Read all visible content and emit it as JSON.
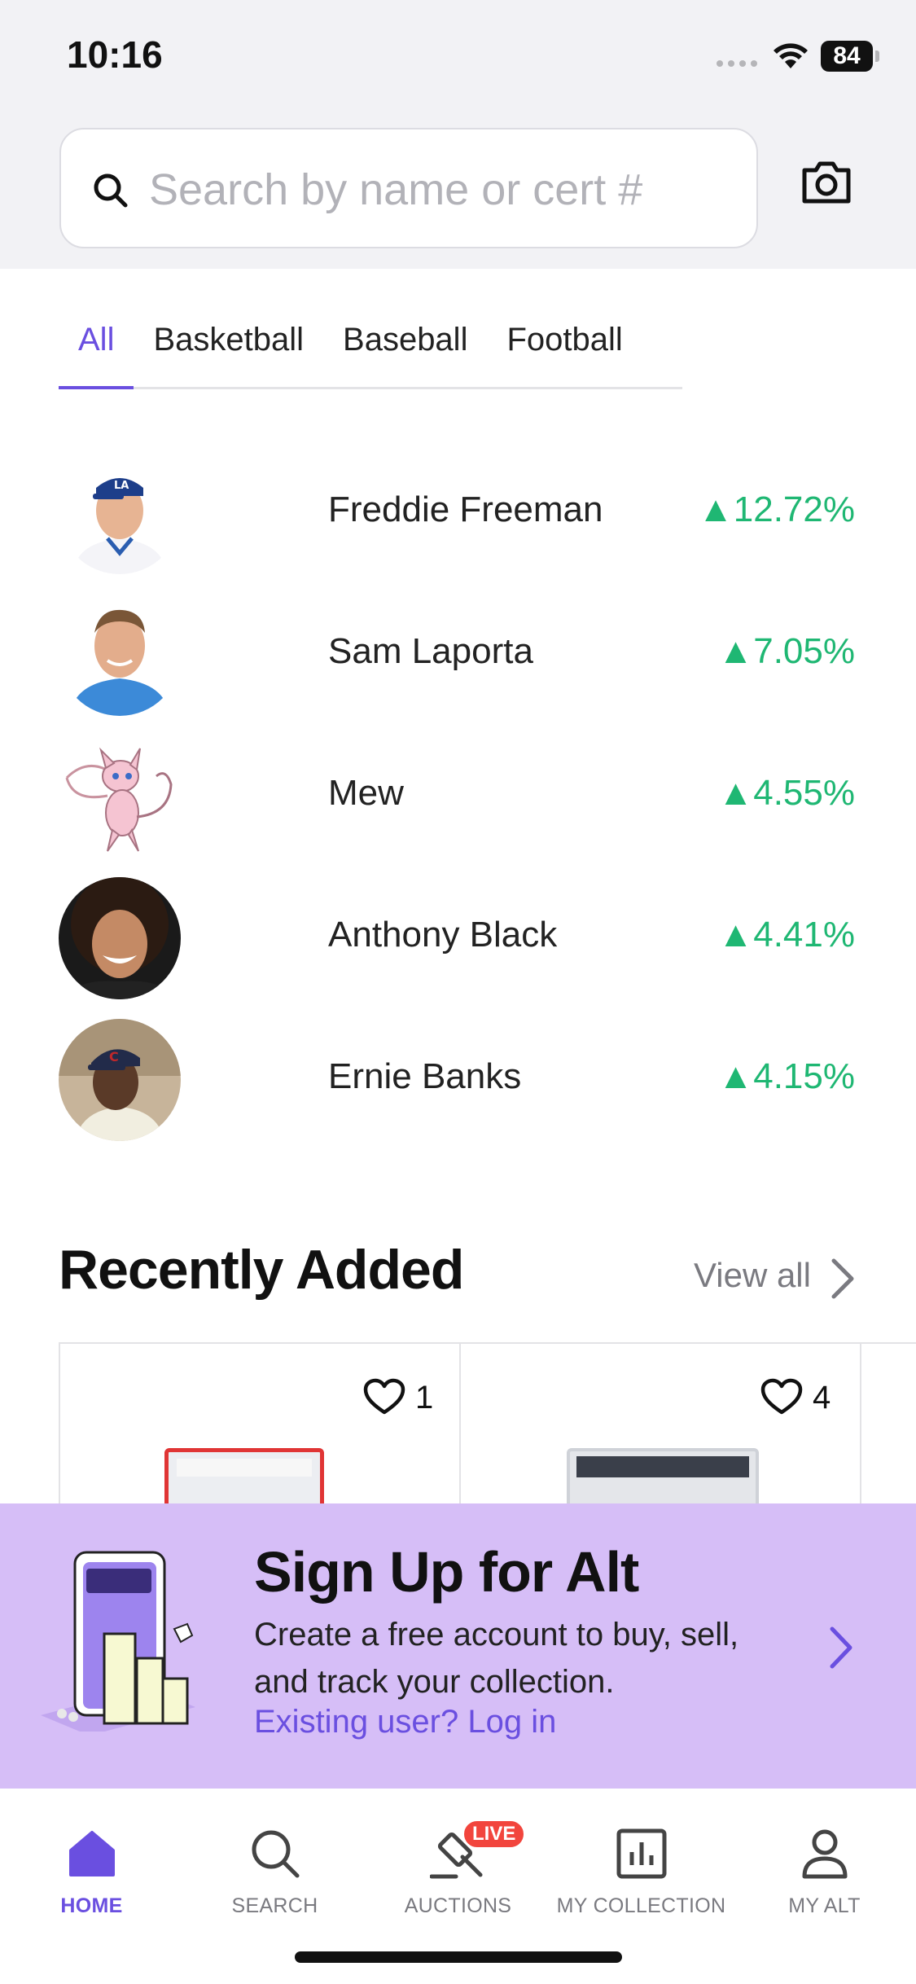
{
  "status_bar": {
    "time": "10:16",
    "battery": "84"
  },
  "search": {
    "placeholder": "Search by name or cert #"
  },
  "tabs": [
    {
      "label": "All",
      "active": true
    },
    {
      "label": "Basketball",
      "active": false
    },
    {
      "label": "Baseball",
      "active": false
    },
    {
      "label": "Football",
      "active": false
    }
  ],
  "movers": [
    {
      "name": "Freddie Freeman",
      "change": "▲12.72%"
    },
    {
      "name": "Sam Laporta",
      "change": "▲7.05%"
    },
    {
      "name": "Mew",
      "change": "▲4.55%"
    },
    {
      "name": "Anthony Black",
      "change": "▲4.41%"
    },
    {
      "name": "Ernie Banks",
      "change": "▲4.15%"
    }
  ],
  "recently_added": {
    "title": "Recently Added",
    "view_all": "View all",
    "cards": [
      {
        "likes": "1"
      },
      {
        "likes": "4"
      }
    ]
  },
  "banner": {
    "title": "Sign Up for Alt",
    "description": "Create a free account to buy, sell, and track your collection.",
    "login_link": "Existing user? Log in"
  },
  "nav": [
    {
      "label": "HOME",
      "icon": "home-icon",
      "active": true
    },
    {
      "label": "SEARCH",
      "icon": "search-icon",
      "active": false
    },
    {
      "label": "AUCTIONS",
      "icon": "gavel-icon",
      "active": false,
      "badge": "LIVE"
    },
    {
      "label": "MY COLLECTION",
      "icon": "chart-icon",
      "active": false
    },
    {
      "label": "MY ALT",
      "icon": "person-icon",
      "active": false
    }
  ],
  "colors": {
    "accent": "#6a4fe0",
    "gain": "#1fb773",
    "banner_bg": "#d6bef7",
    "live": "#f2453d"
  }
}
